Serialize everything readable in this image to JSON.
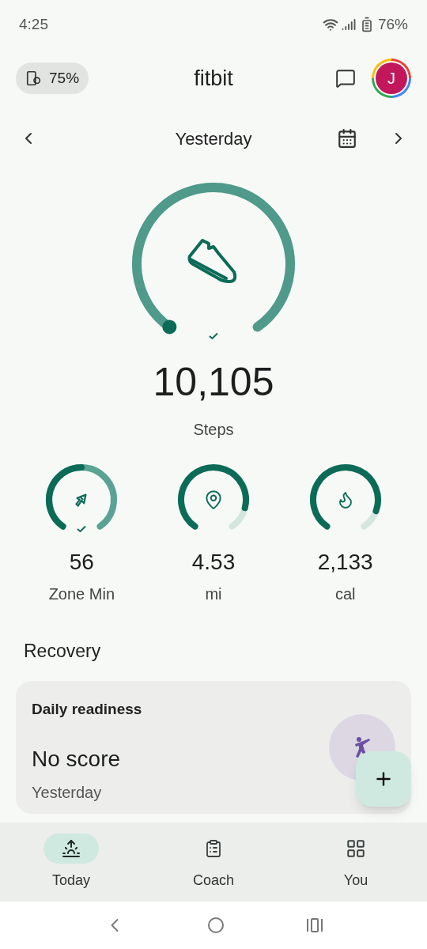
{
  "status_bar": {
    "time": "4:25",
    "battery": "76%"
  },
  "header": {
    "device_battery": "75%",
    "title": "fitbit",
    "avatar_initial": "J"
  },
  "date_nav": {
    "label": "Yesterday"
  },
  "steps": {
    "value": "10,105",
    "label": "Steps",
    "goal_met": true
  },
  "stats": [
    {
      "kind": "zone",
      "value": "56",
      "label": "Zone Min",
      "goal_met": true
    },
    {
      "kind": "distance",
      "value": "4.53",
      "label": "mi",
      "goal_met": false
    },
    {
      "kind": "calories",
      "value": "2,133",
      "label": "cal",
      "goal_met": false
    }
  ],
  "recovery": {
    "heading": "Recovery",
    "card_title": "Daily readiness",
    "score": "No score",
    "date": "Yesterday"
  },
  "bottom_nav": [
    {
      "kind": "today",
      "label": "Today",
      "selected": true
    },
    {
      "kind": "coach",
      "label": "Coach",
      "selected": false
    },
    {
      "kind": "you",
      "label": "You",
      "selected": false
    }
  ]
}
